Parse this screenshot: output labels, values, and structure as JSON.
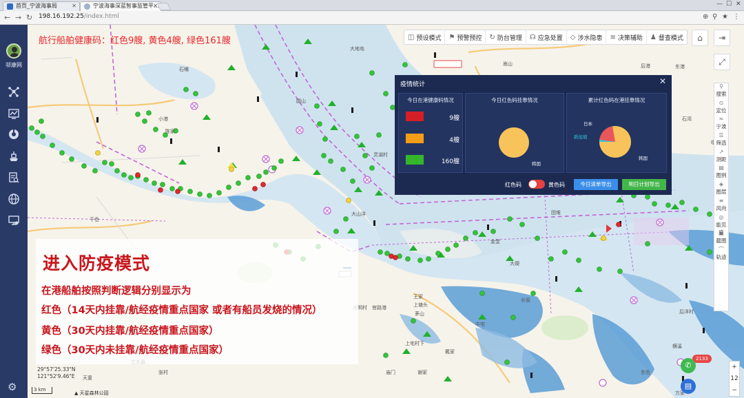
{
  "browser": {
    "tabs": [
      {
        "label": "首页_宁波海事局"
      },
      {
        "label": "宁波海事深蓝智事监管平..."
      }
    ],
    "url_host": "198.16.192.25",
    "url_path": "/index.html"
  },
  "sidebar": {
    "user_name": "邬康网"
  },
  "map": {
    "health_banner": "航行船舶健康码：红色9艘, 黄色4艘, 绿色161艘",
    "toolbar": [
      {
        "icon": "preset-icon",
        "label": "预设模式"
      },
      {
        "icon": "alert-icon",
        "label": "预警预控"
      },
      {
        "icon": "defense-icon",
        "label": "防台管理"
      },
      {
        "icon": "emergency-icon",
        "label": "应急处置"
      },
      {
        "icon": "shield-icon",
        "label": "涉水隐患"
      },
      {
        "icon": "decision-icon",
        "label": "决策辅助"
      },
      {
        "icon": "inspect-icon",
        "label": "督查模式"
      }
    ],
    "right_tools": [
      {
        "icon": "search-icon",
        "label": "搜索"
      },
      {
        "icon": "locate-icon",
        "label": "定位"
      },
      {
        "icon": "wave-icon",
        "label": "宁波"
      },
      {
        "icon": "filter-icon",
        "label": "筛选"
      },
      {
        "icon": "measure-icon",
        "label": "测距"
      },
      {
        "icon": "legend-icon",
        "label": "图例"
      },
      {
        "icon": "layers-icon",
        "label": "图层"
      },
      {
        "icon": "wind-icon",
        "label": "风向"
      },
      {
        "icon": "visibility-icon",
        "label": "能见度"
      },
      {
        "icon": "screenshot-icon",
        "label": "截图"
      },
      {
        "icon": "track-icon",
        "label": "轨迹"
      }
    ],
    "coords": {
      "lat": "29°57'25.33\"N",
      "lon": "121°52'9.46\"E"
    },
    "scale": "3 km",
    "credit": "天星森林公园",
    "zoom_level": "12",
    "badge_count": "2133",
    "place_labels": [
      "大地岛",
      "圆山",
      "东港",
      "临港",
      "后港",
      "石湾",
      "嵩山",
      "大山洋",
      "明安",
      "灵湖村",
      "长坂",
      "中宅",
      "金堂",
      "大碶",
      "小港",
      "陈家",
      "石嘴",
      "干岙",
      "天童",
      "古夫墓",
      "张村",
      "王家",
      "茅山",
      "上宅村下",
      "后洋村",
      "光明村",
      "官路港",
      "上塘头",
      "戴家",
      "庙门",
      "谢家",
      "横溪",
      "方家",
      "东岙",
      "团堆"
    ]
  },
  "panel": {
    "title": "疫情统计",
    "card1_title": "今日在港健康码情况",
    "card1_rows": [
      {
        "color": "#d41f26",
        "value": "9艘"
      },
      {
        "color": "#f59d17",
        "value": "4艘"
      },
      {
        "color": "#35b62b",
        "value": "160艘"
      }
    ],
    "card2_title": "今日红色码挂靠情况",
    "card2_label": "韩国",
    "card3_title": "累计红色码在港挂靠情况",
    "card3_labels": [
      "日本",
      "新加坡",
      "韩国"
    ],
    "toggle_left": "红色码",
    "toggle_right": "黄色码",
    "btn_export_list": "今日清单导出",
    "btn_export_plan": "明日计划导出"
  },
  "overlay": {
    "title": "进入防疫模式",
    "lines": [
      "在港船舶按照判断逻辑分别显示为",
      "红色（14天内挂靠/航经疫情重点国家 或者有船员发烧的情况）",
      "黄色（30天内挂靠/航经疫情重点国家）",
      "绿色（30天内未挂靠/航经疫情重点国家）"
    ]
  },
  "colors": {
    "sidebar": "#2a3a67",
    "panel": "#1c2a52",
    "water": "#cfe3ef",
    "deep_water": "#5b9ed6",
    "alert_red": "#c8161d"
  }
}
